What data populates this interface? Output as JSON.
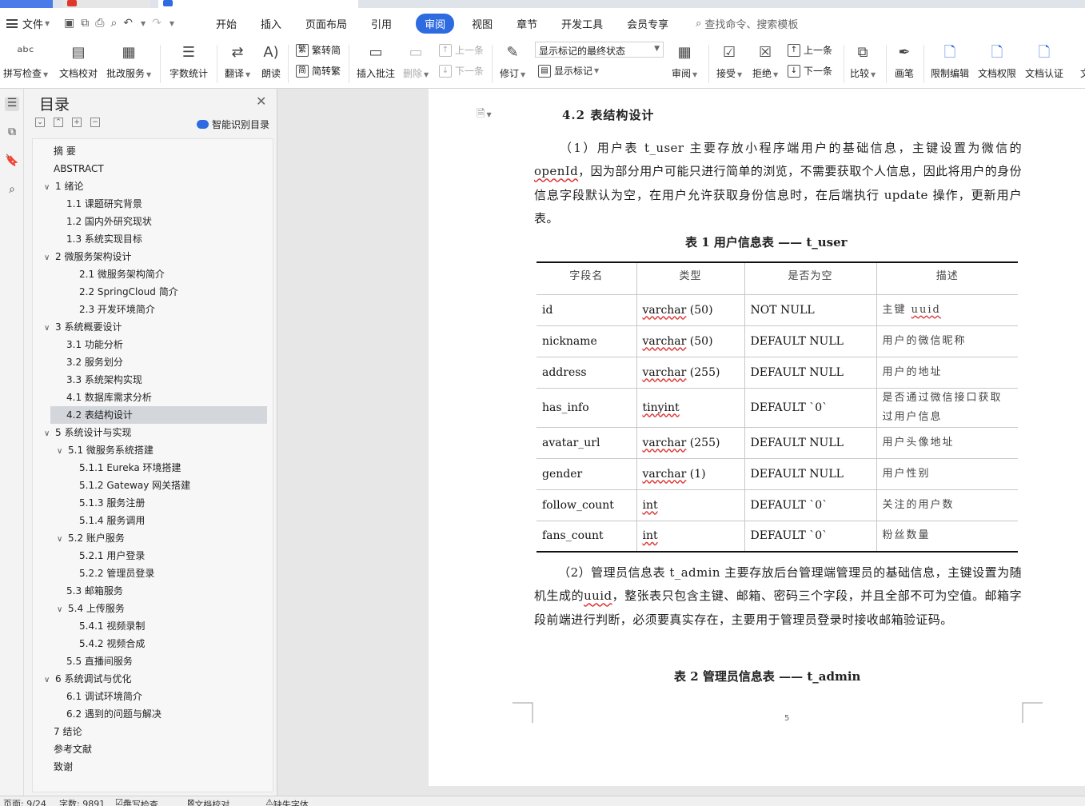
{
  "menubar": {
    "file_label": "文件",
    "tabs": [
      "开始",
      "插入",
      "页面布局",
      "引用",
      "审阅",
      "视图",
      "章节",
      "开发工具",
      "会员专享"
    ],
    "active_tab": "审阅",
    "search_label": "查找命令、搜索模板"
  },
  "ribbon": {
    "spell_check": "拼写检查",
    "doc_proof": "文档校对",
    "batch_service": "批改服务",
    "word_count": "字数统计",
    "translate": "翻译",
    "read_aloud": "朗读",
    "trad_to_simp": "繁转简",
    "simp_to_trad": "简转繁",
    "insert_comment": "插入批注",
    "delete": "删除",
    "prev_comment": "上一条",
    "next_comment": "下一条",
    "revise": "修订",
    "display_combo": "显示标记的最终状态",
    "show_markup": "显示标记",
    "review": "审阅",
    "accept": "接受",
    "reject": "拒绝",
    "prev_change": "上一条",
    "next_change": "下一条",
    "compare": "比较",
    "ink": "画笔",
    "restrict_edit": "限制编辑",
    "doc_permission": "文档权限",
    "doc_cert": "文档认证",
    "more": "文"
  },
  "toc": {
    "title": "目录",
    "ai_label": "智能识别目录",
    "items": [
      {
        "text": "摘  要",
        "level": 0,
        "chev": ""
      },
      {
        "text": "ABSTRACT",
        "level": 0,
        "chev": ""
      },
      {
        "text": "1  绪论",
        "level": 0,
        "chev": "v"
      },
      {
        "text": "1.1  课题研究背景",
        "level": 1,
        "chev": ""
      },
      {
        "text": "1.2  国内外研究现状",
        "level": 1,
        "chev": ""
      },
      {
        "text": "1.3  系统实现目标",
        "level": 1,
        "chev": ""
      },
      {
        "text": "2  微服务架构设计",
        "level": 0,
        "chev": "v"
      },
      {
        "text": "2.1  微服务架构简介",
        "level": 2,
        "chev": ""
      },
      {
        "text": "2.2 SpringCloud 简介",
        "level": 2,
        "chev": ""
      },
      {
        "text": "2.3  开发环境简介",
        "level": 2,
        "chev": ""
      },
      {
        "text": "3  系统概要设计",
        "level": 0,
        "chev": "v"
      },
      {
        "text": "3.1  功能分析",
        "level": 1,
        "chev": ""
      },
      {
        "text": "3.2  服务划分",
        "level": 1,
        "chev": ""
      },
      {
        "text": "3.3  系统架构实现",
        "level": 1,
        "chev": ""
      },
      {
        "text": "4.1  数据库需求分析",
        "level": 1,
        "chev": ""
      },
      {
        "text": "4.2  表结构设计",
        "level": 1,
        "chev": ""
      },
      {
        "text": "5  系统设计与实现",
        "level": 0,
        "chev": "v"
      },
      {
        "text": "5.1  微服务系统搭建",
        "level": 1,
        "chev": "v"
      },
      {
        "text": "5.1.1 Eureka 环境搭建",
        "level": 2,
        "chev": ""
      },
      {
        "text": "5.1.2 Gateway 网关搭建",
        "level": 2,
        "chev": ""
      },
      {
        "text": "5.1.3  服务注册",
        "level": 2,
        "chev": ""
      },
      {
        "text": "5.1.4  服务调用",
        "level": 2,
        "chev": ""
      },
      {
        "text": "5.2  账户服务",
        "level": 1,
        "chev": "v"
      },
      {
        "text": "5.2.1  用户登录",
        "level": 2,
        "chev": ""
      },
      {
        "text": "5.2.2  管理员登录",
        "level": 2,
        "chev": ""
      },
      {
        "text": "5.3  邮箱服务",
        "level": 1,
        "chev": ""
      },
      {
        "text": "5.4  上传服务",
        "level": 1,
        "chev": "v"
      },
      {
        "text": "5.4.1  视频录制",
        "level": 2,
        "chev": ""
      },
      {
        "text": "5.4.2  视频合成",
        "level": 2,
        "chev": ""
      },
      {
        "text": "5.5  直播间服务",
        "level": 1,
        "chev": ""
      },
      {
        "text": "6  系统调试与优化",
        "level": 0,
        "chev": "v"
      },
      {
        "text": "6.1  调试环境简介",
        "level": 1,
        "chev": ""
      },
      {
        "text": "6.2  遇到的问题与解决",
        "level": 1,
        "chev": ""
      },
      {
        "text": "7  结论",
        "level": 0,
        "chev": ""
      },
      {
        "text": "参考文献",
        "level": 0,
        "chev": ""
      },
      {
        "text": "致谢",
        "level": 0,
        "chev": ""
      }
    ],
    "selected": "4.2  表结构设计"
  },
  "doc": {
    "heading": "4.2  表结构设计",
    "para1_a": "（1）用户表 t_user 主要存放小程序端用户的基础信息，主键设置为微信的",
    "para1_b": "openId",
    "para1_c": "，因为部分用户可能只进行简单的浏览，不需要获取个人信息，因此将用户的身份信息字段默认为空，在用户允许获取身份信息时，在后端执行 update 操作，更新用户表。",
    "caption1": "表 1  用户信息表 —— t_user",
    "table_headers": [
      "字段名",
      "类型",
      "是否为空",
      "描述"
    ],
    "table_rows": [
      {
        "field": "id",
        "type_a": "varchar",
        "type_b": " (50)",
        "null": "NOT NULL",
        "desc_a": "主键 ",
        "desc_b": "uuid"
      },
      {
        "field": "nickname",
        "type_a": "varchar",
        "type_b": " (50)",
        "null": "DEFAULT NULL",
        "desc_a": "用户的微信昵称",
        "desc_b": ""
      },
      {
        "field": "address",
        "type_a": "varchar",
        "type_b": " (255)",
        "null": "DEFAULT NULL",
        "desc_a": "用户的地址",
        "desc_b": ""
      },
      {
        "field": "has_info",
        "type_a": "tinyint",
        "type_b": "",
        "null": "DEFAULT  `0`",
        "desc_a": "是否通过微信接口获取过用户信息",
        "desc_b": ""
      },
      {
        "field": "avatar_url",
        "type_a": "varchar",
        "type_b": " (255)",
        "null": "DEFAULT NULL",
        "desc_a": "用户头像地址",
        "desc_b": ""
      },
      {
        "field": "gender",
        "type_a": "varchar",
        "type_b": " (1)",
        "null": "DEFAULT NULL",
        "desc_a": "用户性别",
        "desc_b": ""
      },
      {
        "field": "follow_count",
        "type_a": "int",
        "type_b": "",
        "null": "DEFAULT  `0`",
        "desc_a": "关注的用户数",
        "desc_b": ""
      },
      {
        "field": "fans_count",
        "type_a": "int",
        "type_b": "",
        "null": "DEFAULT  `0`",
        "desc_a": "粉丝数量",
        "desc_b": ""
      }
    ],
    "para2_a": "（2）管理员信息表 t_admin 主要存放后台管理端管理员的基础信息，主键设置为随机生成的",
    "para2_b": "uuid",
    "para2_c": "，整张表只包含主键、邮箱、密码三个字段，并且全部不可为空值。邮箱字段前端进行判断，必须要真实存在，主要用于管理员登录时接收邮箱验证码。",
    "caption2": "表 2  管理员信息表 —— t_admin",
    "page_number": "5"
  },
  "status": {
    "page": "页面: 9/24",
    "words": "字数: 9891",
    "spell": "拼写检查",
    "proof": "文档校对",
    "missing_font": "缺失字体"
  }
}
